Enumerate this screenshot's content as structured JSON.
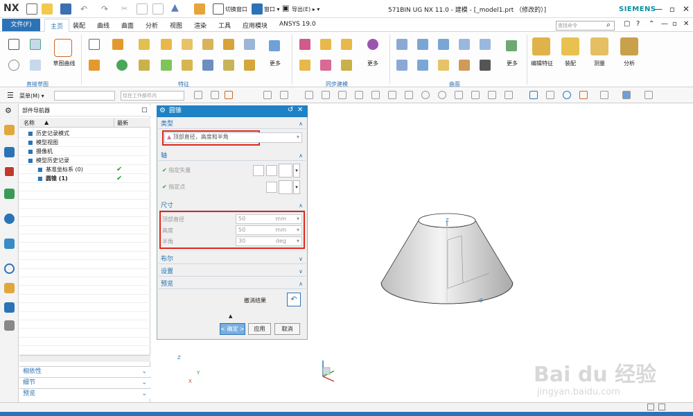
{
  "app": {
    "logo": "NX",
    "title": "571BIN UG NX 11.0 - 建模 - [_model1.prt （修改的）]",
    "vendor": "SIEMENS",
    "switch_window": "切换窗口",
    "window_menu": "窗口 ▾",
    "export_menu": "导出(E) ▸ ▾"
  },
  "menu": {
    "file": "文件(F)",
    "tabs": [
      "主页",
      "装配",
      "曲线",
      "曲面",
      "分析",
      "视图",
      "渲染",
      "工具",
      "应用模块",
      "ANSYS 19.0"
    ],
    "search_placeholder": "查找命令"
  },
  "ribbon": {
    "sketch_btn": "草图曲线",
    "group_direct_sketch": "直接草图",
    "group_feature": "特征",
    "group_sync": "同步建模",
    "group_surface": "曲面",
    "more": "更多",
    "edit_feature": "编辑特征",
    "assembly": "装配",
    "measure": "测量",
    "analysis": "分析"
  },
  "toolbar2": {
    "menu_btn": "菜单(M) ▾",
    "filter_placeholder": "仅在工作部件内"
  },
  "navigator": {
    "title": "部件导航器",
    "col_name": "名称",
    "col_latest": "最新",
    "rows": [
      {
        "text": "历史记录模式",
        "indent": 6
      },
      {
        "text": "模型视图",
        "indent": 6
      },
      {
        "text": "摄像机",
        "indent": 6
      },
      {
        "text": "模型历史记录",
        "indent": 6
      },
      {
        "text": "基准坐标系 (0)",
        "indent": 20,
        "check": "✔"
      },
      {
        "text": "圆锥 (1)",
        "indent": 20,
        "check": "✔"
      }
    ],
    "folds": [
      "相依性",
      "细节",
      "预览"
    ]
  },
  "dialog": {
    "title": "圆锥",
    "sec_type": "类型",
    "type_value": "顶部直径，高度和半角",
    "sec_axis": "轴",
    "spec_vector": "指定矢量",
    "spec_point": "指定点",
    "sec_dim": "尺寸",
    "dims": [
      {
        "label": "顶部直径",
        "value": "50",
        "unit": "mm"
      },
      {
        "label": "高度",
        "value": "50",
        "unit": "mm"
      },
      {
        "label": "半角",
        "value": "30",
        "unit": "deg"
      }
    ],
    "sec_bool": "布尔",
    "sec_settings": "设置",
    "sec_preview": "预览",
    "undo_result": "撤消结果",
    "ok": "< 确定 >",
    "apply": "应用",
    "cancel": "取消"
  },
  "viewport": {
    "axis_z": "Z",
    "axis_x": "X",
    "axis_y": "Y"
  },
  "watermark": {
    "brand": "Bai du 经验",
    "url": "jingyan.baidu.com"
  },
  "colors": {
    "accent": "#2b73b6",
    "dialog_header": "#1f82c6",
    "highlight_box": "#e0261b",
    "check": "#2aa02a"
  }
}
